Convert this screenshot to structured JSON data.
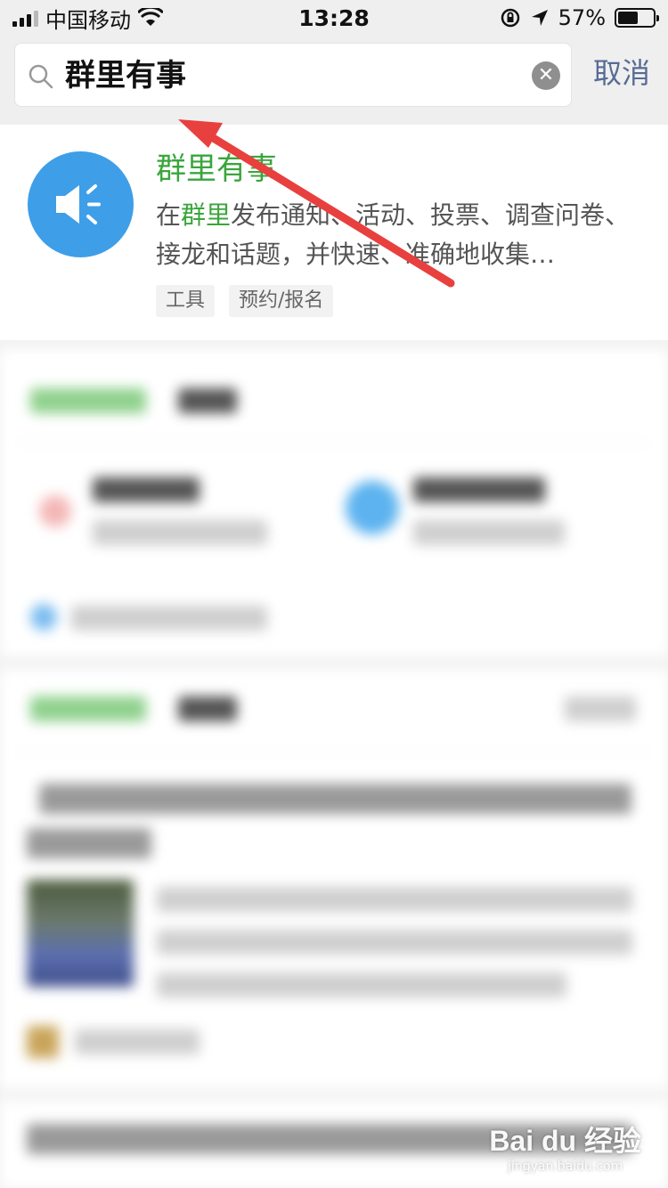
{
  "status_bar": {
    "carrier": "中国移动",
    "time": "13:28",
    "battery_percent": "57%",
    "battery_level": 0.57
  },
  "search": {
    "query": "群里有事",
    "cancel_label": "取消"
  },
  "result": {
    "title": "群里有事",
    "desc_prefix": "在",
    "desc_highlight": "群里",
    "desc_rest": "发布通知、活动、投票、调查问卷、接龙和话题，并快速、准确地收集…",
    "tags": [
      "工具",
      "预约/报名"
    ]
  },
  "watermark": {
    "main": "Bai du 经验",
    "sub": "jingyan.baidu.com"
  },
  "colors": {
    "highlight_green": "#3aa53b",
    "link_blue": "#576b95",
    "icon_blue": "#3e9ee8",
    "arrow_red": "#e8403e"
  }
}
